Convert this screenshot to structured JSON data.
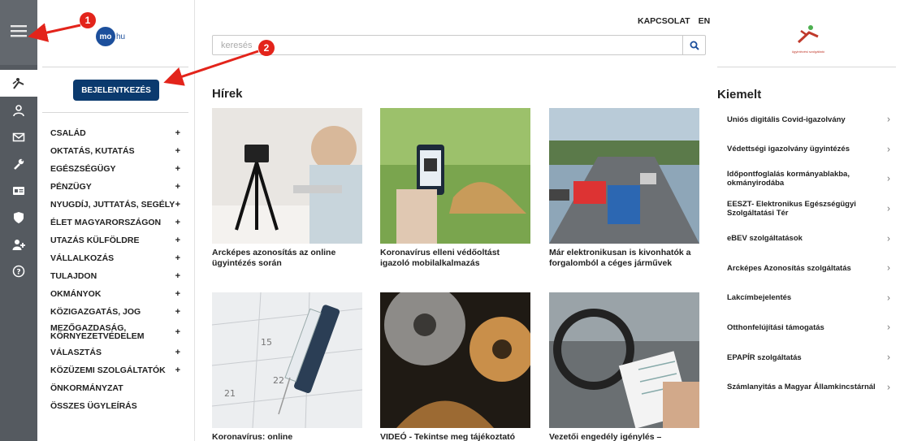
{
  "topbar": {
    "contact": "KAPCSOLAT",
    "lang": "EN"
  },
  "logo": {
    "mo": "mo",
    "hu": "hu"
  },
  "search": {
    "placeholder": "keresés"
  },
  "login": {
    "label": "BEJELENTKEZÉS"
  },
  "rail": {
    "icons": [
      "menu-icon",
      "person-icon",
      "user-icon",
      "mail-icon",
      "wrench-icon",
      "id-card-icon",
      "shield-icon",
      "add-user-icon",
      "help-icon"
    ]
  },
  "categories": [
    "CSALÁD",
    "OKTATÁS, KUTATÁS",
    "EGÉSZSÉGÜGY",
    "PÉNZÜGY",
    "NYUGDÍJ, JUTTATÁS, SEGÉLY",
    "ÉLET MAGYARORSZÁGON",
    "UTAZÁS KÜLFÖLDRE",
    "VÁLLALKOZÁS",
    "TULAJDON",
    "OKMÁNYOK",
    "KÖZIGAZGATÁS, JOG",
    "MEZŐGAZDASÁG, KÖRNYEZETVÉDELEM",
    "VÁLASZTÁS",
    "KÖZÜZEMI SZOLGÁLTATÓK",
    "ÖNKORMÁNYZAT",
    "ÖSSZES ÜGYLEÍRÁS"
  ],
  "plus": "+",
  "news": {
    "title": "Hírek",
    "items": [
      "Arcképes azonosítás az online ügyintézés során",
      "Koronavírus elleni védőoltást igazoló mobilalkalmazás",
      "Már elektronikusan is kivonhatók a forgalomból a céges járművek",
      "Koronavírus: online",
      "VIDEÓ - Tekintse meg tájékoztató",
      "Vezetői engedély igénylés –"
    ]
  },
  "featured": {
    "title": "Kiemelt",
    "logo_text": "ügyintézési szolgáltató",
    "items": [
      "Uniós digitális Covid-igazolvány",
      "Védettségi igazolvány ügyintézés",
      "Időpontfoglalás kormányablakba, okmányirodába",
      "EESZT- Elektronikus Egészségügyi Szolgáltatási Tér",
      "eBEV szolgáltatások",
      "Arcképes Azonosítás szolgáltatás",
      "Lakcímbejelentés",
      "Otthonfelújítási támogatás",
      "EPAPÍR szolgáltatás",
      "Számlanyitás a Magyar Államkincstárnál"
    ],
    "chevron": "›"
  },
  "annotations": {
    "marker1": "1",
    "marker2": "2"
  },
  "colors": {
    "accent": "#0b3a6e",
    "marker": "#e3241b",
    "rail": "#555a60"
  }
}
